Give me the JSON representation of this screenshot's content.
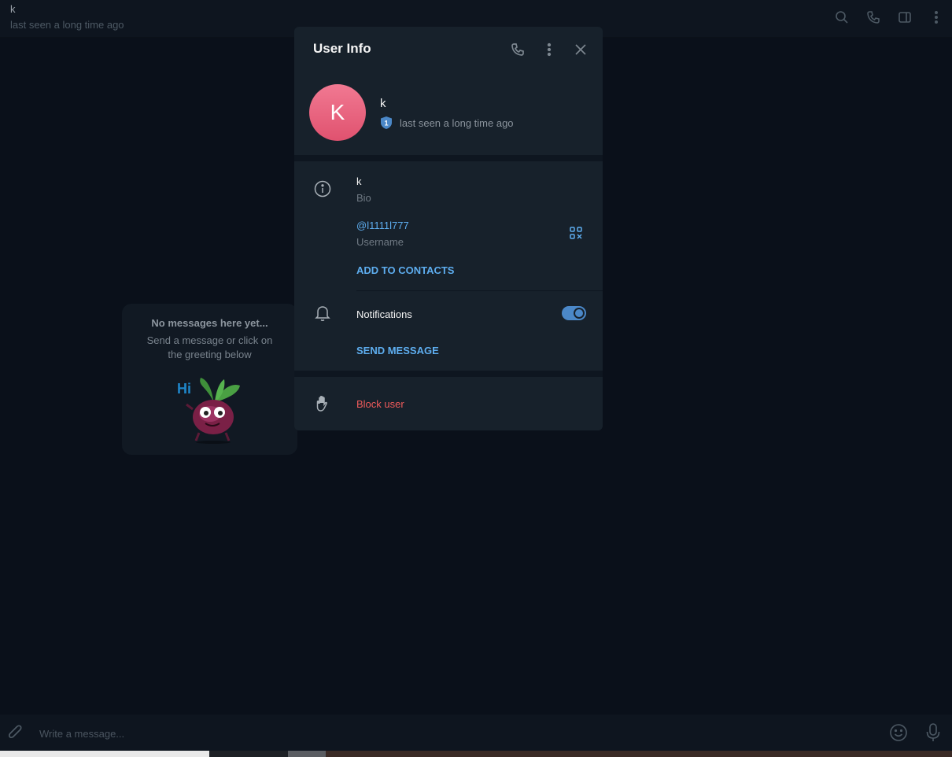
{
  "chat_header": {
    "name": "k",
    "status": "last seen a long time ago",
    "icons": [
      "search-icon",
      "phone-icon",
      "sidebar-icon",
      "more-vert-icon"
    ]
  },
  "empty_chat": {
    "title": "No messages here yet...",
    "text": "Send a message or click on the greeting below",
    "sticker": "beet-hi-sticker"
  },
  "modal": {
    "title": "User Info",
    "header_icons": [
      "phone-icon",
      "more-vert-icon",
      "close-icon"
    ],
    "user": {
      "avatar_letter": "K",
      "avatar_color": "#e8607c",
      "name": "k",
      "badge": "1",
      "status": "last seen a long time ago"
    },
    "bio": {
      "value": "k",
      "label": "Bio"
    },
    "username": {
      "value": "@l1111l777",
      "label": "Username"
    },
    "add_to_contacts": "ADD TO CONTACTS",
    "notifications": {
      "label": "Notifications",
      "enabled": true
    },
    "send_message": "SEND MESSAGE",
    "block_user": "Block user"
  },
  "input_bar": {
    "placeholder": "Write a message..."
  },
  "colors": {
    "accent": "#5eaef0",
    "danger": "#ef5b5b",
    "modal_bg": "#17212b",
    "page_bg": "#0a101a"
  }
}
